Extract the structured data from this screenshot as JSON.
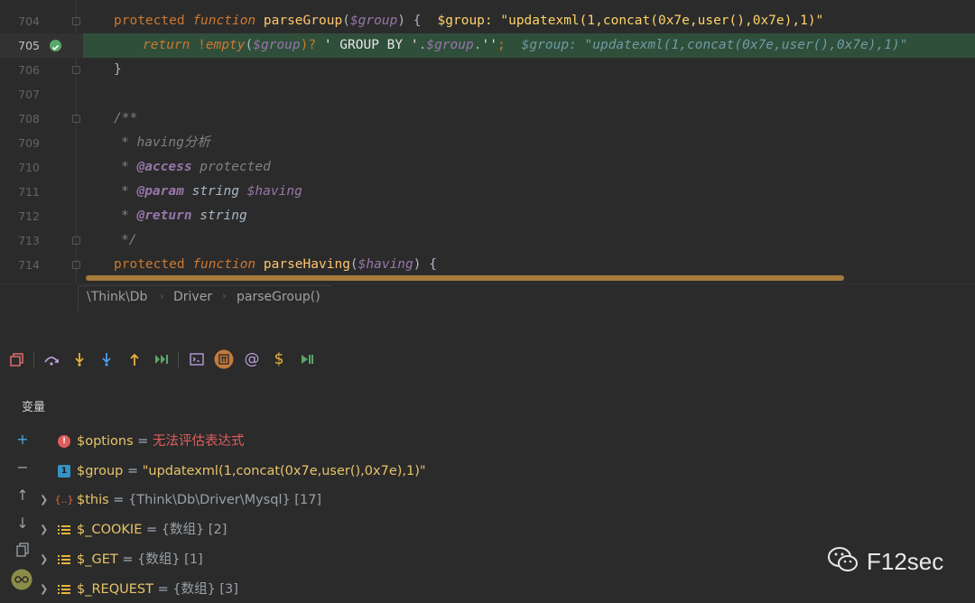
{
  "editor": {
    "lines": [
      {
        "num": "704"
      },
      {
        "num": "705"
      },
      {
        "num": "706"
      },
      {
        "num": "707"
      },
      {
        "num": "708"
      },
      {
        "num": "709"
      },
      {
        "num": "710"
      },
      {
        "num": "711"
      },
      {
        "num": "712"
      },
      {
        "num": "713"
      },
      {
        "num": "714"
      }
    ],
    "l704": {
      "kw1": "protected",
      "kw2": "function",
      "fn": "parseGroup",
      "p1": "(",
      "var": "$group",
      "p2": ") {",
      "inline": "$group: \"updatexml(1,concat(0x7e,user(),0x7e),1)\""
    },
    "l705": {
      "kw": "return",
      "op": " !",
      "fn": "empty",
      "p1": "(",
      "var": "$group",
      "p2": ")? ",
      "s1": "' GROUP BY '",
      "p3": ".",
      "var2": "$group",
      "p4": ".",
      "s2": "''",
      "p5": ";",
      "inline": "$group: \"updatexml(1,concat(0x7e,user(),0x7e),1)\""
    },
    "l706": {
      "text": "}"
    },
    "l708": {
      "text": "/**"
    },
    "l709": {
      "star": "* ",
      "text": "having分析"
    },
    "l710": {
      "star": "* ",
      "tag": "@access",
      "text": " protected"
    },
    "l711": {
      "star": "* ",
      "tag": "@param",
      "type": " string ",
      "var": "$having"
    },
    "l712": {
      "star": "* ",
      "tag": "@return",
      "type": " string"
    },
    "l713": {
      "text": "*/"
    },
    "l714": {
      "kw1": "protected",
      "kw2": "function",
      "fn": "parseHaving",
      "p1": "(",
      "var": "$having",
      "p2": ") {"
    }
  },
  "breadcrumb": [
    "\\Think\\Db",
    "Driver",
    "parseGroup()"
  ],
  "debug": {
    "vars_title": "变量",
    "variables": [
      {
        "name": "$options",
        "eq": " = ",
        "value": "无法评估表达式",
        "kind": "error"
      },
      {
        "name": "$group",
        "eq": " = ",
        "value": "\"updatexml(1,concat(0x7e,user(),0x7e),1)\"",
        "kind": "string"
      },
      {
        "name": "$this",
        "eq": " = ",
        "value": "{Think\\Db\\Driver\\Mysql} [17]",
        "kind": "object"
      },
      {
        "name": "$_COOKIE",
        "eq": " = ",
        "value": "{数组} [2]",
        "kind": "array"
      },
      {
        "name": "$_GET",
        "eq": " = ",
        "value": "{数组} [1]",
        "kind": "array"
      },
      {
        "name": "$_REQUEST",
        "eq": " = ",
        "value": "{数组} [3]",
        "kind": "array"
      }
    ],
    "object_icon": "{..}",
    "string_icon": "1",
    "toolbar_icons": [
      "frames-icon",
      "step-over-icon",
      "step-into-icon",
      "force-step-into-icon",
      "step-out-icon",
      "run-to-cursor-icon",
      "console-icon",
      "php-icon",
      "watch-icon",
      "dollar-icon",
      "resume-icon"
    ]
  },
  "watermark": {
    "text": "F12sec"
  },
  "colors": {
    "accent": "#a57c3c",
    "current_line": "#2f4f3a",
    "error": "#e05d5d"
  }
}
